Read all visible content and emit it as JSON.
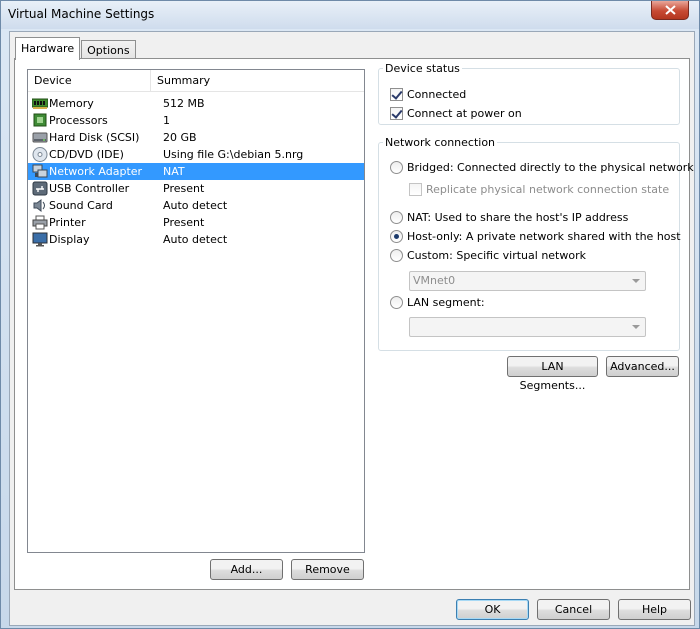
{
  "window": {
    "title": "Virtual Machine Settings"
  },
  "tabs": [
    {
      "label": "Hardware",
      "active": true
    },
    {
      "label": "Options",
      "active": false
    }
  ],
  "device_list": {
    "columns": [
      "Device",
      "Summary"
    ],
    "rows": [
      {
        "device": "Memory",
        "summary": "512 MB",
        "icon": "memory-icon"
      },
      {
        "device": "Processors",
        "summary": "1",
        "icon": "processor-icon"
      },
      {
        "device": "Hard Disk (SCSI)",
        "summary": "20 GB",
        "icon": "hard-disk-icon"
      },
      {
        "device": "CD/DVD (IDE)",
        "summary": "Using file G:\\debian 5.nrg",
        "icon": "cd-dvd-icon"
      },
      {
        "device": "Network Adapter",
        "summary": "NAT",
        "icon": "network-adapter-icon",
        "selected": true
      },
      {
        "device": "USB Controller",
        "summary": "Present",
        "icon": "usb-icon"
      },
      {
        "device": "Sound Card",
        "summary": "Auto detect",
        "icon": "sound-card-icon"
      },
      {
        "device": "Printer",
        "summary": "Present",
        "icon": "printer-icon"
      },
      {
        "device": "Display",
        "summary": "Auto detect",
        "icon": "display-icon"
      }
    ],
    "add_label": "Add...",
    "remove_label": "Remove"
  },
  "device_status": {
    "legend": "Device status",
    "connected_label": "Connected",
    "connected_checked": true,
    "power_on_label": "Connect at power on",
    "power_on_checked": true
  },
  "network_connection": {
    "legend": "Network connection",
    "bridged_label": "Bridged: Connected directly to the physical network",
    "replicate_label": "Replicate physical network connection state",
    "nat_label": "NAT: Used to share the host's IP address",
    "host_only_label": "Host-only: A private network shared with the host",
    "custom_label": "Custom: Specific virtual network",
    "vmnet_value": "VMnet0",
    "lan_segment_label": "LAN segment:",
    "lan_segment_value": "",
    "selected": "host-only"
  },
  "buttons": {
    "lan_segments": "LAN Segments...",
    "advanced": "Advanced...",
    "ok": "OK",
    "cancel": "Cancel",
    "help": "Help"
  },
  "colors": {
    "selection": "#3399ff",
    "close_button": "#c74a34"
  }
}
